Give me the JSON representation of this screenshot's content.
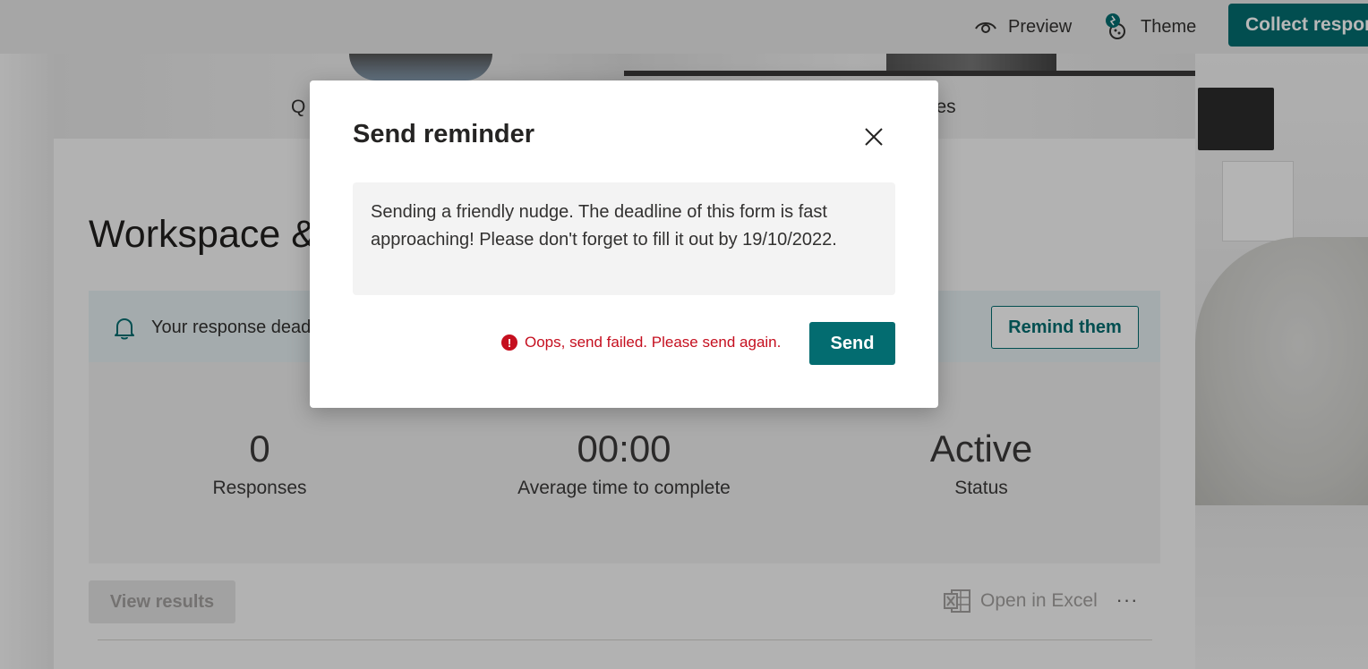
{
  "header": {
    "preview_label": "Preview",
    "theme_label": "Theme",
    "collect_label": "Collect respon",
    "accent_color": "#036c70"
  },
  "card": {
    "tab_questions_partial": "Q",
    "tab_responses_partial": "ses",
    "title_partial": "Workspace &",
    "deadline_partial": "Your response dead",
    "remind_label": "Remind them",
    "stats": [
      {
        "value": "0",
        "label": "Responses"
      },
      {
        "value": "00:00",
        "label": "Average time to complete"
      },
      {
        "value": "Active",
        "label": "Status"
      }
    ],
    "view_results_label": "View results",
    "open_excel_label": "Open in Excel",
    "more_label": "···"
  },
  "dialog": {
    "title": "Send reminder",
    "message": "Sending a friendly nudge. The deadline of this form is fast approaching! Please don't forget to fill it out by 19/10/2022.",
    "error_icon_glyph": "!",
    "error_text": "Oops, send failed. Please send again.",
    "error_color": "#c50f1f",
    "send_label": "Send"
  }
}
